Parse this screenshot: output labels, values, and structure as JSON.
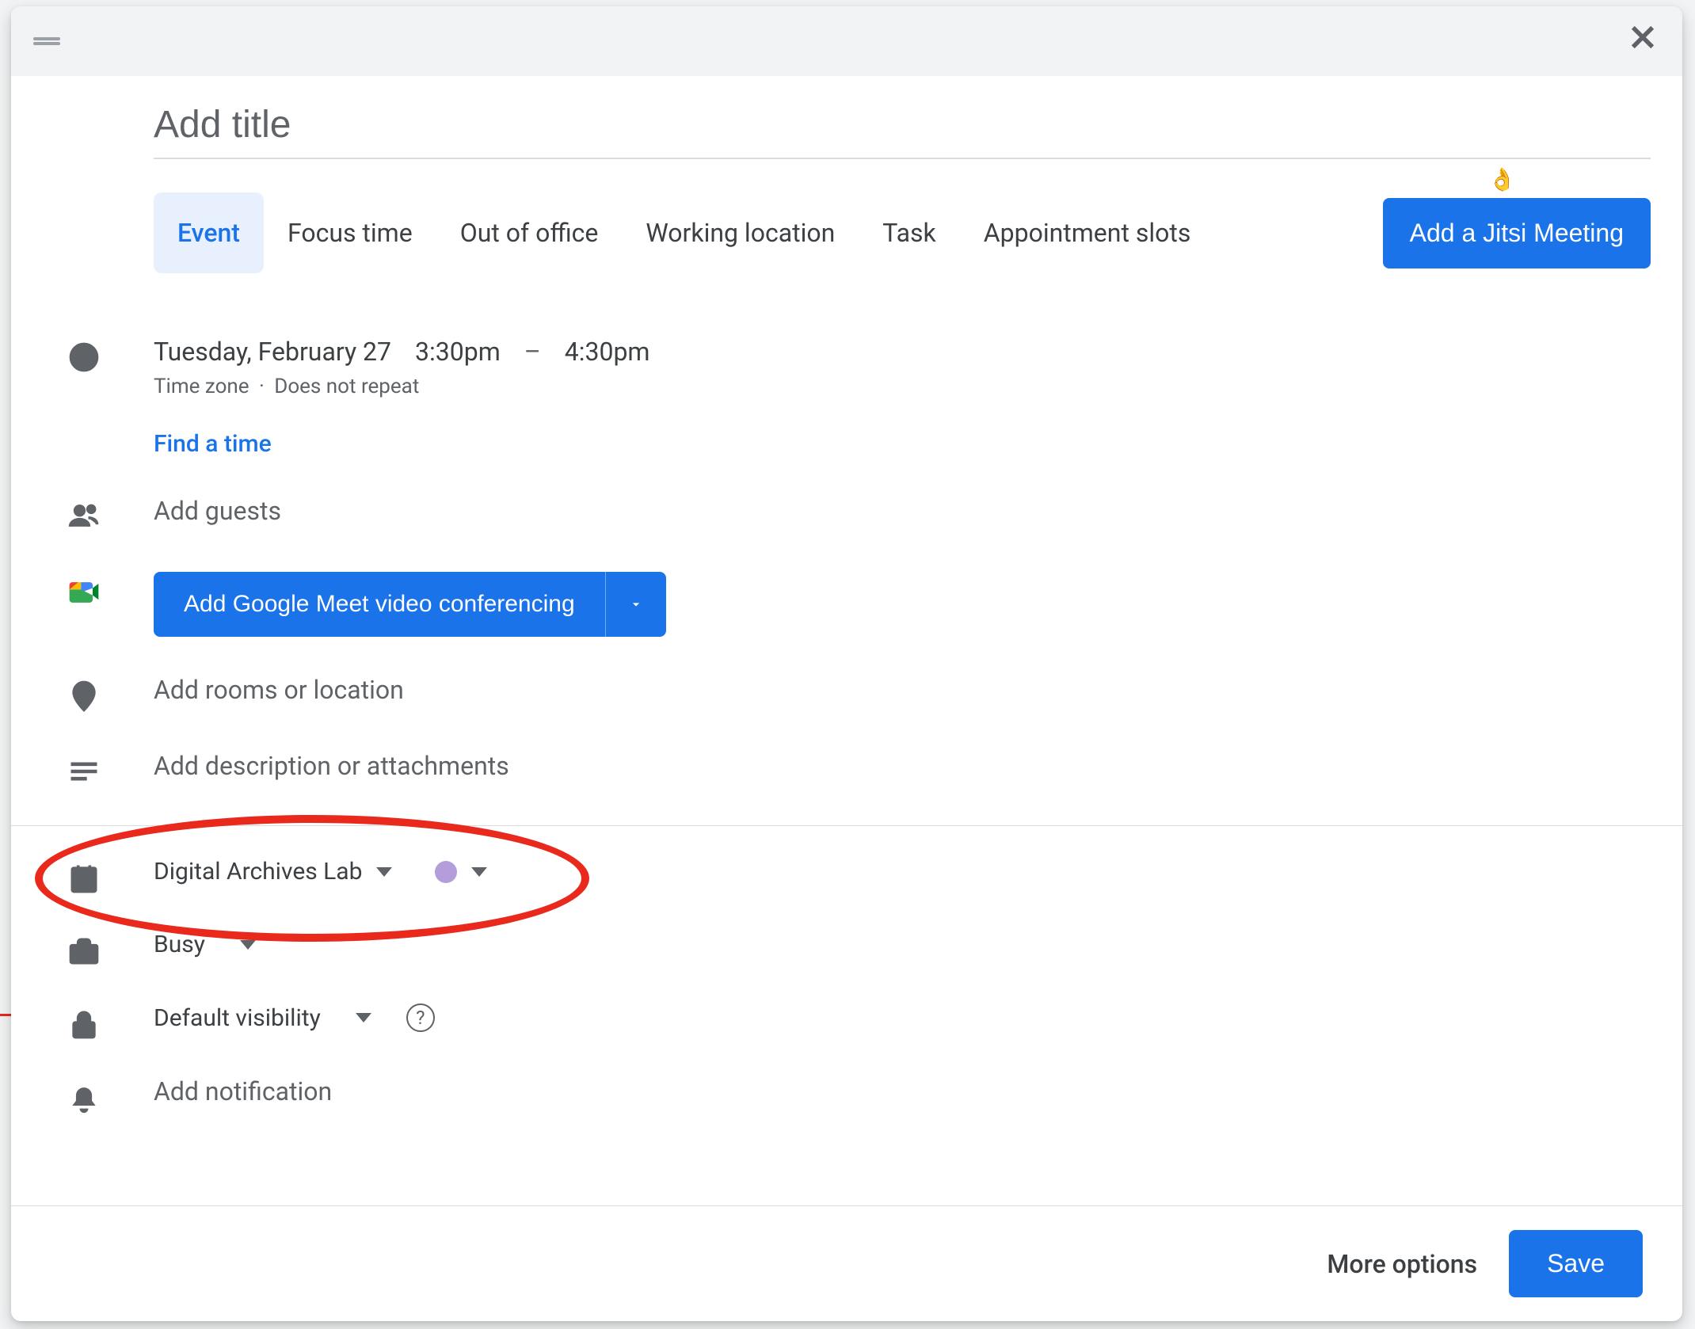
{
  "title_placeholder": "Add title",
  "tabs": {
    "event": "Event",
    "focus_time": "Focus time",
    "out_of_office": "Out of office",
    "working_location": "Working location",
    "task": "Task",
    "appointment_slots": "Appointment slots"
  },
  "jitsi_button": "Add a Jitsi Meeting",
  "datetime": {
    "date": "Tuesday, February 27",
    "start": "3:30pm",
    "dash": "–",
    "end": "4:30pm",
    "timezone": "Time zone",
    "repeat": "Does not repeat"
  },
  "find_a_time": "Find a time",
  "add_guests": "Add guests",
  "meet_button": "Add Google Meet video conferencing",
  "add_location": "Add rooms or location",
  "add_description": "Add description or attachments",
  "calendar_select": "Digital Archives Lab",
  "calendar_color": "#b39ddb",
  "availability": "Busy",
  "visibility": "Default visibility",
  "add_notification": "Add notification",
  "footer": {
    "more_options": "More options",
    "save": "Save"
  }
}
